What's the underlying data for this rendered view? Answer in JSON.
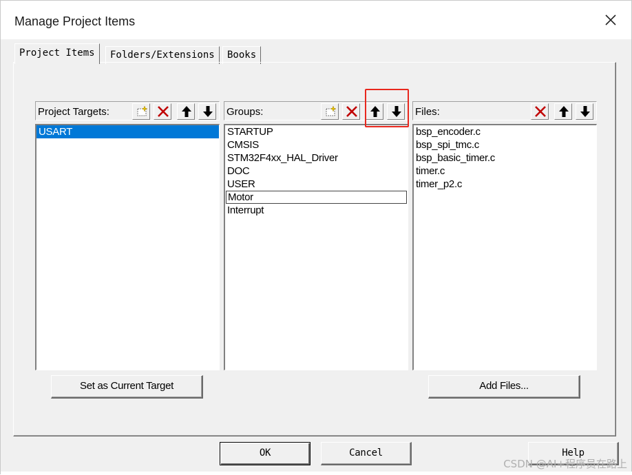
{
  "window": {
    "title": "Manage Project Items"
  },
  "tabs": [
    {
      "label": "Project Items",
      "active": true
    },
    {
      "label": "Folders/Extensions",
      "active": false
    },
    {
      "label": "Books",
      "active": false
    }
  ],
  "targets": {
    "label": "Project Targets:",
    "items": [
      "USART"
    ],
    "selected_index": 0
  },
  "groups": {
    "label": "Groups:",
    "items": [
      "STARTUP",
      "CMSIS",
      "STM32F4xx_HAL_Driver",
      "DOC",
      "USER",
      "Motor",
      "Interrupt"
    ],
    "focused_index": 5
  },
  "files": {
    "label": "Files:",
    "items": [
      "bsp_encoder.c",
      "bsp_spi_tmc.c",
      "bsp_basic_timer.c",
      "timer.c",
      "timer_p2.c"
    ]
  },
  "buttons": {
    "set_current_target": "Set as Current Target",
    "add_files": "Add Files...",
    "ok": "OK",
    "cancel": "Cancel",
    "help": "Help"
  },
  "watermark": "CSDN @AI+程序员在路上",
  "colors": {
    "selection": "#0078d7",
    "delete_icon": "#c00000",
    "highlight_box": "#e8271d",
    "dialog_bg": "#f0f0f0"
  },
  "icons": [
    "new-icon",
    "delete-icon",
    "move-up-icon",
    "move-down-icon",
    "close-icon"
  ]
}
